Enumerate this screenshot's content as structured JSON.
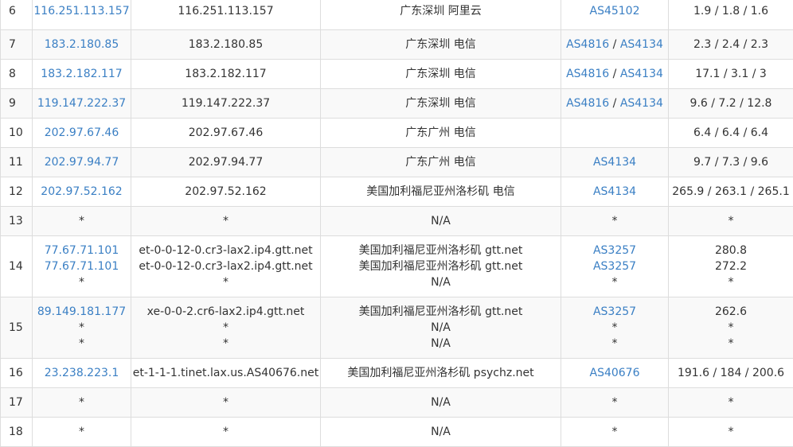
{
  "colors": {
    "link": "#3a7fc4",
    "text": "#333333",
    "border": "#dddddd",
    "stripe": "#f9f9f9"
  },
  "rows": [
    {
      "hop": "6",
      "h": 48,
      "ip": [
        "116.251.113.157"
      ],
      "host": [
        "116.251.113.157"
      ],
      "loc": [
        "广东深圳 阿里云"
      ],
      "asn": [
        [
          "AS45102"
        ]
      ],
      "time": [
        "1.9 / 1.8 / 1.6"
      ]
    },
    {
      "hop": "7",
      "h": 37,
      "ip": [
        "183.2.180.85"
      ],
      "host": [
        "183.2.180.85"
      ],
      "loc": [
        "广东深圳 电信"
      ],
      "asn": [
        [
          "AS4816",
          "AS4134"
        ]
      ],
      "time": [
        "2.3 / 2.4 / 2.3"
      ]
    },
    {
      "hop": "8",
      "h": 37,
      "ip": [
        "183.2.182.117"
      ],
      "host": [
        "183.2.182.117"
      ],
      "loc": [
        "广东深圳 电信"
      ],
      "asn": [
        [
          "AS4816",
          "AS4134"
        ]
      ],
      "time": [
        "17.1 / 3.1 / 3"
      ]
    },
    {
      "hop": "9",
      "h": 37,
      "ip": [
        "119.147.222.37"
      ],
      "host": [
        "119.147.222.37"
      ],
      "loc": [
        "广东深圳 电信"
      ],
      "asn": [
        [
          "AS4816",
          "AS4134"
        ]
      ],
      "time": [
        "9.6 / 7.2 / 12.8"
      ]
    },
    {
      "hop": "10",
      "h": 37,
      "ip": [
        "202.97.67.46"
      ],
      "host": [
        "202.97.67.46"
      ],
      "loc": [
        "广东广州 电信"
      ],
      "asn": [
        []
      ],
      "time": [
        "6.4 / 6.4 / 6.4"
      ]
    },
    {
      "hop": "11",
      "h": 37,
      "ip": [
        "202.97.94.77"
      ],
      "host": [
        "202.97.94.77"
      ],
      "loc": [
        "广东广州 电信"
      ],
      "asn": [
        [
          "AS4134"
        ]
      ],
      "time": [
        "9.7 / 7.3 / 9.6"
      ]
    },
    {
      "hop": "12",
      "h": 37,
      "ip": [
        "202.97.52.162"
      ],
      "host": [
        "202.97.52.162"
      ],
      "loc": [
        "美国加利福尼亚州洛杉矶 电信"
      ],
      "asn": [
        [
          "AS4134"
        ]
      ],
      "time": [
        "265.9 / 263.1 / 265.1"
      ]
    },
    {
      "hop": "13",
      "h": 37,
      "ip": [
        "*"
      ],
      "host": [
        "*"
      ],
      "loc": [
        "N/A"
      ],
      "asn": [
        [
          "*"
        ]
      ],
      "time": [
        "*"
      ]
    },
    {
      "hop": "14",
      "h": 77,
      "ip": [
        "77.67.71.101",
        "77.67.71.101",
        "*"
      ],
      "host": [
        "et-0-0-12-0.cr3-lax2.ip4.gtt.net",
        "et-0-0-12-0.cr3-lax2.ip4.gtt.net",
        "*"
      ],
      "loc": [
        "美国加利福尼亚州洛杉矶 gtt.net",
        "美国加利福尼亚州洛杉矶 gtt.net",
        "N/A"
      ],
      "asn": [
        [
          "AS3257"
        ],
        [
          "AS3257"
        ],
        [
          "*"
        ]
      ],
      "time": [
        "280.8",
        "272.2",
        "*"
      ]
    },
    {
      "hop": "15",
      "h": 77,
      "ip": [
        "89.149.181.177",
        "*",
        "*"
      ],
      "host": [
        "xe-0-0-2.cr6-lax2.ip4.gtt.net",
        "*",
        "*"
      ],
      "loc": [
        "美国加利福尼亚州洛杉矶 gtt.net",
        "N/A",
        "N/A"
      ],
      "asn": [
        [
          "AS3257"
        ],
        [
          "*"
        ],
        [
          "*"
        ]
      ],
      "time": [
        "262.6",
        "*",
        "*"
      ]
    },
    {
      "hop": "16",
      "h": 37,
      "ip": [
        "23.238.223.1"
      ],
      "host": [
        "et-1-1-1.tinet.lax.us.AS40676.net"
      ],
      "loc": [
        "美国加利福尼亚州洛杉矶 psychz.net"
      ],
      "asn": [
        [
          "AS40676"
        ]
      ],
      "time": [
        "191.6 / 184 / 200.6"
      ]
    },
    {
      "hop": "17",
      "h": 37,
      "ip": [
        "*"
      ],
      "host": [
        "*"
      ],
      "loc": [
        "N/A"
      ],
      "asn": [
        [
          "*"
        ]
      ],
      "time": [
        "*"
      ]
    },
    {
      "hop": "18",
      "h": 37,
      "ip": [
        "*"
      ],
      "host": [
        "*"
      ],
      "loc": [
        "N/A"
      ],
      "asn": [
        [
          "*"
        ]
      ],
      "time": [
        "*"
      ]
    }
  ]
}
